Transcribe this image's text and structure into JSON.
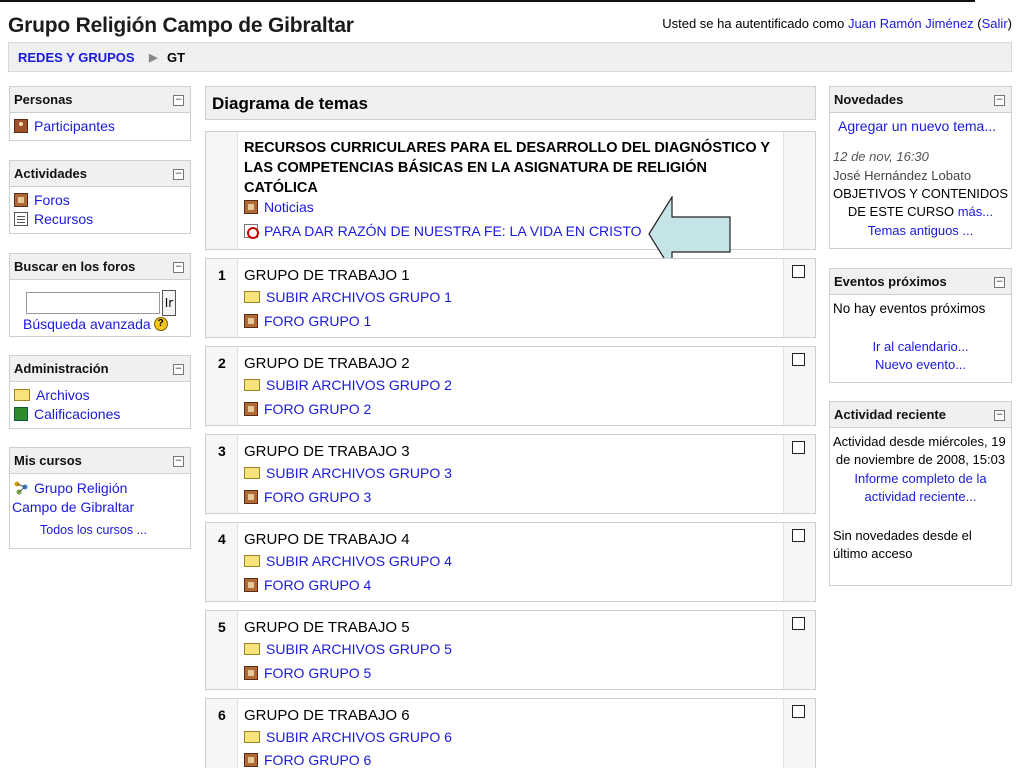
{
  "site": {
    "title": "Grupo Religión Campo de Gibraltar",
    "login_prefix": "Usted se ha autentificado como",
    "user_name": "Juan Ramón Jiménez",
    "logout": "Salir"
  },
  "breadcrumb": {
    "root": "REDES Y GRUPOS",
    "separator": "▶",
    "current": "GT"
  },
  "left": {
    "personas": {
      "title": "Personas",
      "items": [
        "Participantes"
      ]
    },
    "actividades": {
      "title": "Actividades",
      "items": [
        "Foros",
        "Recursos"
      ]
    },
    "buscar": {
      "title": "Buscar en los foros",
      "button": "Ir",
      "advanced": "Búsqueda avanzada",
      "help": "?"
    },
    "administracion": {
      "title": "Administración",
      "items": [
        "Archivos",
        "Calificaciones"
      ]
    },
    "mis_cursos": {
      "title": "Mis cursos",
      "course_line1": "Grupo Religión",
      "course_line2": "Campo de Gibraltar",
      "all": "Todos los cursos ..."
    }
  },
  "main": {
    "title": "Diagrama de temas",
    "section0": {
      "title": "RECURSOS CURRICULARES PARA EL DESARROLLO DEL DIAGNÓSTICO Y LAS COMPETENCIAS BÁSICAS EN LA ASIGNATURA DE RELIGIÓN CATÓLICA",
      "news": "Noticias",
      "resource": "PARA DAR RAZÓN DE NUESTRA FE: LA VIDA EN CRISTO"
    },
    "sections": [
      {
        "num": "1",
        "title": "GRUPO DE TRABAJO 1",
        "upload": "SUBIR ARCHIVOS GRUPO 1",
        "forum": "FORO GRUPO 1"
      },
      {
        "num": "2",
        "title": "GRUPO DE TRABAJO 2",
        "upload": "SUBIR ARCHIVOS GRUPO 2",
        "forum": "FORO GRUPO 2"
      },
      {
        "num": "3",
        "title": "GRUPO DE TRABAJO 3",
        "upload": "SUBIR ARCHIVOS GRUPO 3",
        "forum": "FORO GRUPO 3"
      },
      {
        "num": "4",
        "title": "GRUPO DE TRABAJO 4",
        "upload": "SUBIR ARCHIVOS GRUPO 4",
        "forum": "FORO GRUPO 4"
      },
      {
        "num": "5",
        "title": "GRUPO DE TRABAJO 5",
        "upload": "SUBIR ARCHIVOS GRUPO 5",
        "forum": "FORO GRUPO 5"
      },
      {
        "num": "6",
        "title": "GRUPO DE TRABAJO 6",
        "upload": "SUBIR ARCHIVOS GRUPO 6",
        "forum": "FORO GRUPO 6"
      }
    ]
  },
  "right": {
    "novedades": {
      "title": "Novedades",
      "add": "Agregar un nuevo tema...",
      "date": "12 de nov, 16:30",
      "author": "José Hernández Lobato",
      "post_line1": "OBJETIVOS Y CONTENIDOS",
      "post_line2": "DE ESTE CURSO",
      "more": "más...",
      "old": "Temas antiguos ..."
    },
    "eventos": {
      "title": "Eventos próximos",
      "none": "No hay eventos próximos",
      "calendar": "Ir al calendario...",
      "new": "Nuevo evento..."
    },
    "actividad": {
      "title": "Actividad reciente",
      "since_line1": "Actividad desde miércoles, 19",
      "since_line2": "de noviembre de 2008, 15:03",
      "report_line1": "Informe completo de la",
      "report_line2": "actividad reciente...",
      "none_line1": "Sin novedades desde el",
      "none_line2": "último acceso"
    }
  },
  "colors": {
    "link": "#1a1adf",
    "arrow_fill": "#c5e4e8"
  }
}
